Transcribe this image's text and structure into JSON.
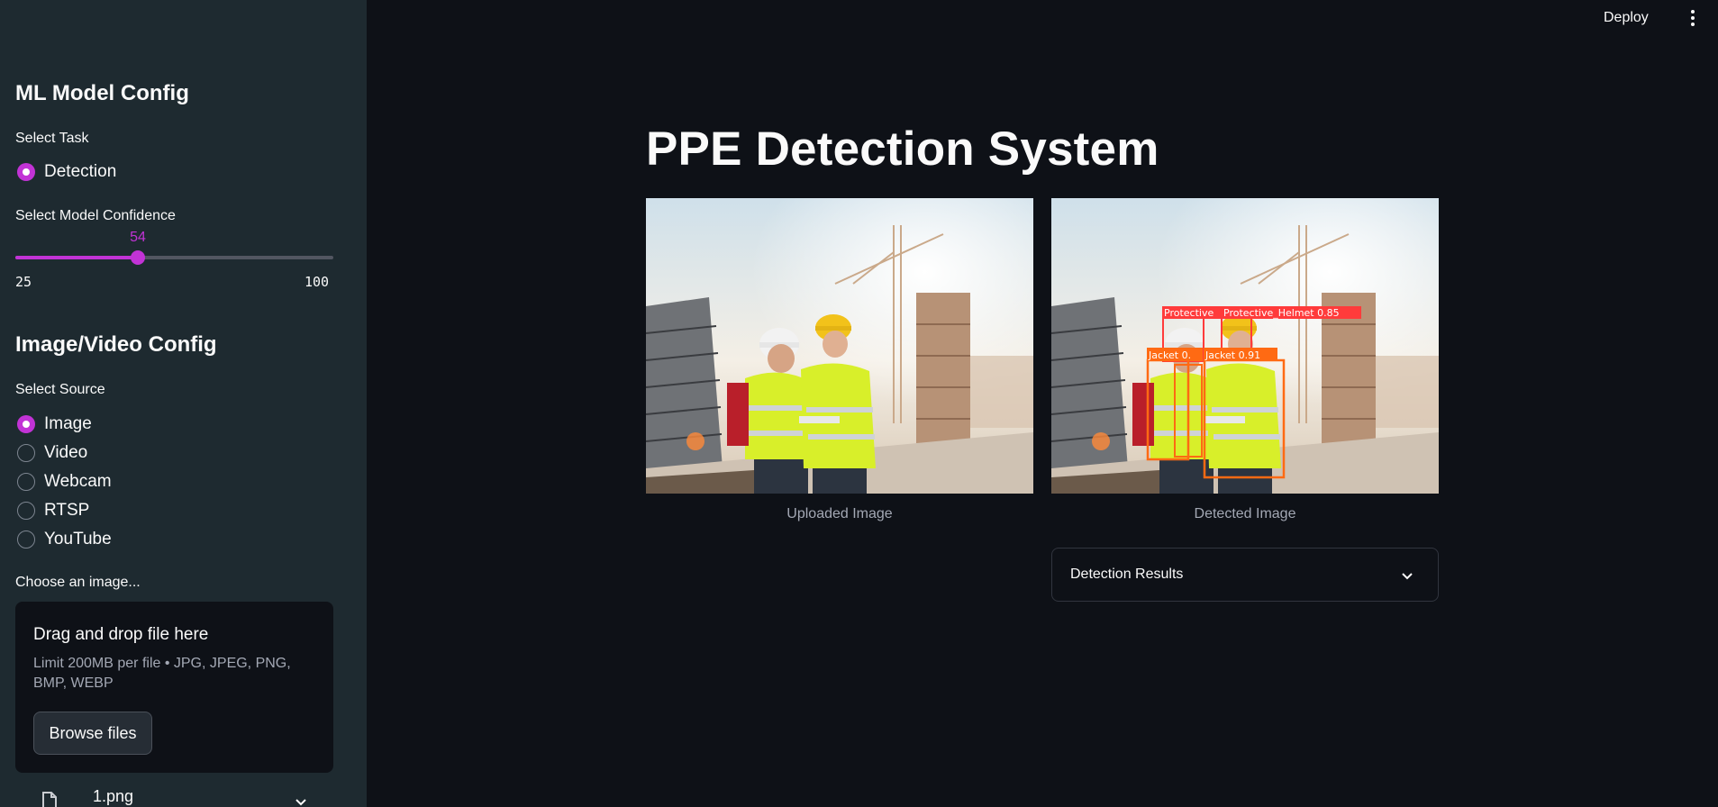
{
  "header": {
    "deploy_label": "Deploy",
    "menu_icon": "kebab-menu-icon"
  },
  "sidebar": {
    "model_heading": "ML Model Config",
    "task_label": "Select Task",
    "task_options": [
      {
        "label": "Detection",
        "selected": true
      }
    ],
    "confidence_label": "Select Model Confidence",
    "confidence": {
      "value": 54,
      "min": 25,
      "max": 100
    },
    "source_heading": "Image/Video Config",
    "source_label": "Select Source",
    "source_options": [
      {
        "label": "Image",
        "selected": true
      },
      {
        "label": "Video",
        "selected": false
      },
      {
        "label": "Webcam",
        "selected": false
      },
      {
        "label": "RTSP",
        "selected": false
      },
      {
        "label": "YouTube",
        "selected": false
      }
    ],
    "uploader_label": "Choose an image...",
    "uploader": {
      "title": "Drag and drop file here",
      "hint": "Limit 200MB per file • JPG, JPEG, PNG, BMP, WEBP",
      "browse_label": "Browse files"
    },
    "uploaded_file": {
      "name": "1.png",
      "icon": "file-icon"
    }
  },
  "main": {
    "title": "PPE Detection System",
    "uploaded_caption": "Uploaded Image",
    "detected_caption": "Detected Image",
    "detections": [
      {
        "label": "Protective"
      },
      {
        "label": "Protective_Helmet 0.85"
      },
      {
        "label": "Jacket 0."
      },
      {
        "label": "Jacket 0.91"
      }
    ],
    "expander_label": "Detection Results"
  },
  "colors": {
    "accent": "#c233d6",
    "background": "#0e1117",
    "sidebar": "#1e2a30",
    "helmet_box": "#ff3b3b",
    "jacket_box": "#ff6a13"
  }
}
